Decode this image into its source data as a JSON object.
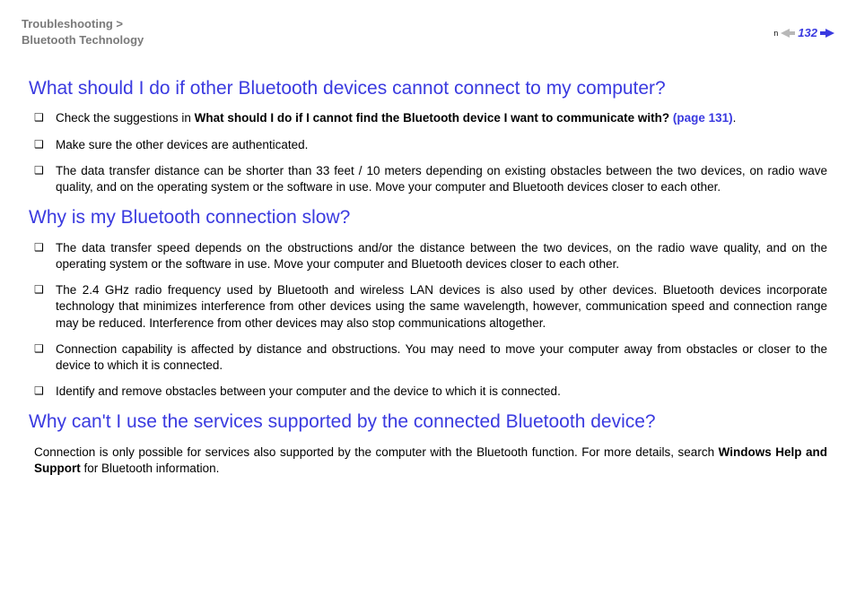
{
  "breadcrumb": {
    "line1": "Troubleshooting >",
    "line2": "Bluetooth Technology"
  },
  "pageNumber": "132",
  "nMark": "n",
  "sections": [
    {
      "heading": "What should I do if other Bluetooth devices cannot connect to my computer?",
      "items": [
        {
          "prefix": "Check the suggestions in ",
          "bold": "What should I do if I cannot find the Bluetooth device I want to communicate with? ",
          "link": "(page 131)",
          "suffix": "."
        },
        {
          "text": "Make sure the other devices are authenticated."
        },
        {
          "text": "The data transfer distance can be shorter than 33 feet / 10 meters depending on existing obstacles between the two devices, on radio wave quality, and on the operating system or the software in use. Move your computer and Bluetooth devices closer to each other."
        }
      ]
    },
    {
      "heading": "Why is my Bluetooth connection slow?",
      "items": [
        {
          "text": "The data transfer speed depends on the obstructions and/or the distance between the two devices, on the radio wave quality, and on the operating system or the software in use. Move your computer and Bluetooth devices closer to each other."
        },
        {
          "text": "The 2.4 GHz radio frequency used by Bluetooth and wireless LAN devices is also used by other devices. Bluetooth devices incorporate technology that minimizes interference from other devices using the same wavelength, however, communication speed and connection range may be reduced. Interference from other devices may also stop communications altogether."
        },
        {
          "text": "Connection capability is affected by distance and obstructions. You may need to move your computer away from obstacles or closer to the device to which it is connected."
        },
        {
          "text": "Identify and remove obstacles between your computer and the device to which it is connected."
        }
      ]
    },
    {
      "heading": "Why can't I use the services supported by the connected Bluetooth device?",
      "para": {
        "prefix": "Connection is only possible for services also supported by the computer with the Bluetooth function. For more details, search ",
        "bold": "Windows Help and Support",
        "suffix": " for Bluetooth information."
      }
    }
  ]
}
